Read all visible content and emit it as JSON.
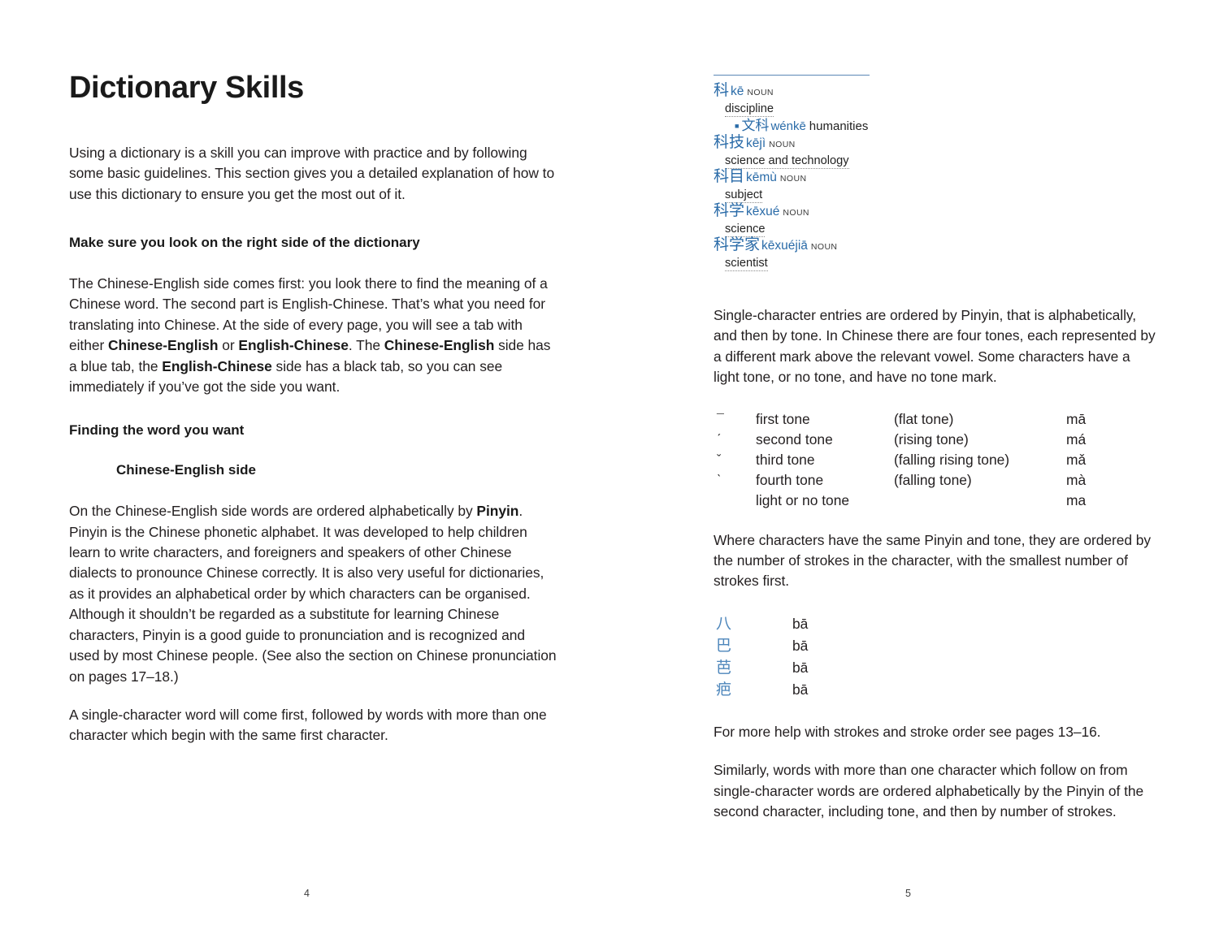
{
  "document": {
    "chapter_title": "Dictionary Skills"
  },
  "left_page": {
    "folio": "4",
    "intro": "Using a dictionary is a skill you can improve with practice and by following some basic guidelines. This section gives you a detailed explanation of how to use this dictionary to ensure you get the most out of it.",
    "section1": {
      "heading": "Make sure you look on the right side of the dictionary",
      "para_parts": {
        "p1": "The Chinese-English side comes first: you look there to find the meaning of a Chinese word. The second part is English-Chinese. That’s what you need for translating into Chinese. At the side of every page, you will see a tab with either ",
        "b1": "Chinese-English",
        "p2": " or ",
        "b2": "English-Chinese",
        "p3": ". The ",
        "b3": "Chinese-English",
        "p4": " side has a blue tab, the ",
        "b4": "English-Chinese",
        "p5": " side has a black tab, so you can see immediately if you’ve got the side you want."
      }
    },
    "section2": {
      "heading": "Finding the word you want",
      "subheading": "Chinese-English side",
      "para_parts": {
        "p1": "On the Chinese-English side words are ordered alphabetically by ",
        "b1": "Pinyin",
        "p2": ". Pinyin is the Chinese phonetic alphabet. It was developed to help children learn to write characters, and foreigners and speakers of other Chinese dialects to pronounce Chinese correctly. It is also very useful for dictionaries, as it provides an alphabetical order by which characters can be organised. Although it shouldn’t be regarded as a substitute for learning Chinese characters, Pinyin is a good guide to pronunciation and is recognized and used by most Chinese people. (See also the section on Chinese pronunciation on pages 17–18.)"
      },
      "para_final": "A single-character word will come first, followed by words with more than one character which begin with the same first character."
    }
  },
  "right_page": {
    "folio": "5",
    "dictionary_sample": {
      "entries": [
        {
          "headword": "科",
          "pinyin": "kē",
          "pos": "NOUN",
          "definition": "discipline",
          "subentry": {
            "bullet": "■",
            "headword": "文科",
            "pinyin": "wénkē",
            "gloss": "humanities"
          }
        },
        {
          "headword": "科技",
          "pinyin": "kējì",
          "pos": "NOUN",
          "definition": "science and technology"
        },
        {
          "headword": "科目",
          "pinyin": "kēmù",
          "pos": "NOUN",
          "definition": "subject"
        },
        {
          "headword": "科学",
          "pinyin": "kēxué",
          "pos": "NOUN",
          "definition": "science"
        },
        {
          "headword": "科学家",
          "pinyin": "kēxuéjiā",
          "pos": "NOUN",
          "definition": "scientist"
        }
      ]
    },
    "para_tones_intro": "Single-character entries are ordered by Pinyin, that is alphabetically, and then by tone. In Chinese there are four tones, each represented by a different mark above the relevant vowel. Some characters have a light tone, or no tone, and have no tone mark.",
    "tone_table": {
      "rows": [
        {
          "mark": "¯",
          "name": "first tone",
          "desc": "(flat tone)",
          "example": "mā"
        },
        {
          "mark": "ˊ",
          "name": "second tone",
          "desc": "(rising tone)",
          "example": "má"
        },
        {
          "mark": "ˇ",
          "name": "third tone",
          "desc": "(falling rising tone)",
          "example": "mǎ"
        },
        {
          "mark": "ˋ",
          "name": "fourth tone",
          "desc": "(falling tone)",
          "example": "mà"
        },
        {
          "mark": "",
          "name": "light or no tone",
          "desc": "",
          "example": "ma"
        }
      ]
    },
    "para_strokes": "Where characters have the same Pinyin and tone, they are ordered by the number of strokes in the character, with the smallest number of strokes first.",
    "stroke_table": {
      "rows": [
        {
          "character": "八",
          "pinyin": "bā"
        },
        {
          "character": "巴",
          "pinyin": "bā"
        },
        {
          "character": "芭",
          "pinyin": "bā"
        },
        {
          "character": "疤",
          "pinyin": "bā"
        }
      ]
    },
    "para_more_help": "For more help with strokes and stroke order see pages 13–16.",
    "para_similarly": "Similarly, words with more than one character which follow on from single-character words are ordered alphabetically by the Pinyin of the second character, including tone, and then by number of strokes."
  }
}
